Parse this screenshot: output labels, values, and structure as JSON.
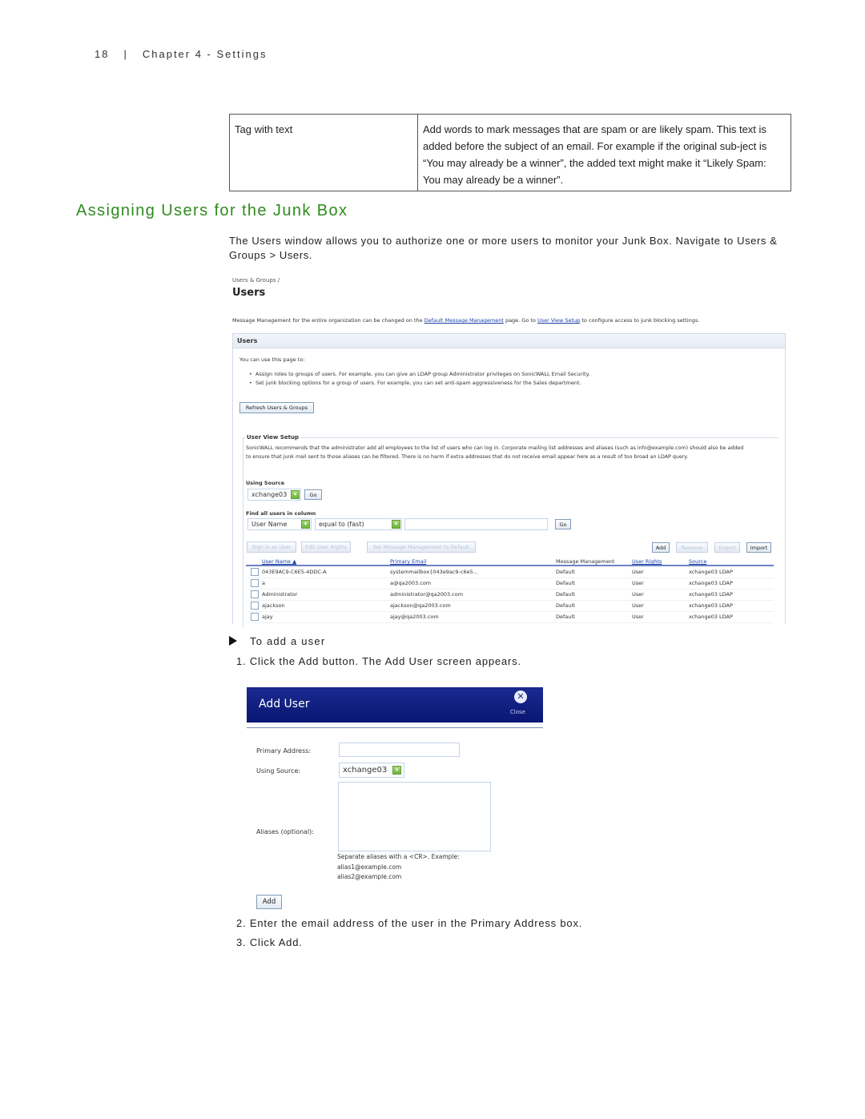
{
  "header": {
    "page_number": "18",
    "separator": "|",
    "chapter": "Chapter 4 - Settings"
  },
  "definition_table": {
    "rows": [
      {
        "term": "Tag with text",
        "description": "Add words to mark messages that are spam or are likely spam. This text is added before the subject of an email. For example if the original sub-ject is “You may already be a winner”, the added text might make it “Likely Spam: You may already be a winner”."
      }
    ]
  },
  "section": {
    "title": "Assigning Users for the Junk Box",
    "intro": "The Users window allows you to authorize one or more users to monitor your Junk Box. Navigate to Users & Groups > Users."
  },
  "users_screen": {
    "breadcrumb": "Users & Groups /",
    "title": "Users",
    "desc_pre": "Message Management for the entire organization can be changed on the ",
    "desc_link1": "Default Message Management",
    "desc_mid": " page. Go to ",
    "desc_link2": "User View Setup",
    "desc_post": " to configure access to junk blocking settings.",
    "panel_title": "Users",
    "lead": "You can use this page to:",
    "bullets": [
      "Assign roles to groups of users. For example, you can give an LDAP group Administrator privileges on SonicWALL Email Security.",
      "Set junk blocking options for a group of users. For example, you can set anti-spam aggressiveness for the Sales department."
    ],
    "refresh_button": "Refresh Users & Groups",
    "user_view_setup": {
      "legend": "User View Setup",
      "text_line1": "SonicWALL recommends that the administrator add all employees to the list of users who can log in. Corporate mailing list addresses and aliases (such as info@example.com) should also be added",
      "text_line2": "to ensure that junk mail sent to those aliases can be filtered. There is no harm if extra addresses that do not receive email appear here as a result of too broad an LDAP query.",
      "using_source_label": "Using Source",
      "using_source_value": "xchange03",
      "go_label": "Go",
      "find_label": "Find all users in column",
      "find_column_value": "User Name",
      "find_operator_value": "equal to (fast)",
      "find_text_value": "",
      "find_go_label": "Go"
    },
    "actions": {
      "sign_in": "Sign in as User",
      "edit_rights": "Edit User Rights",
      "set_default": "Set Message Management to Default",
      "add": "Add",
      "remove": "Remove",
      "export": "Export",
      "import": "Import"
    },
    "table": {
      "columns": [
        "User Name ▲",
        "Primary Email",
        "Message Management",
        "User Rights",
        "Source"
      ],
      "rows": [
        [
          "043E9AC9-C6E5-4DDC-A",
          "systemmailbox{043e9ac9-c6e5...",
          "Default",
          "User",
          "xchange03 LDAP"
        ],
        [
          "a",
          "a@qa2003.com",
          "Default",
          "User",
          "xchange03 LDAP"
        ],
        [
          "Administrator",
          "administrator@qa2003.com",
          "Default",
          "User",
          "xchange03 LDAP"
        ],
        [
          "ajackson",
          "ajackson@qa2003.com",
          "Default",
          "User",
          "xchange03 LDAP"
        ],
        [
          "ajay",
          "ajay@qa2003.com",
          "Default",
          "User",
          "xchange03 LDAP"
        ]
      ]
    }
  },
  "procedure": {
    "title": "To add a user",
    "steps": [
      "1. Click the Add button. The Add User screen appears.",
      "2. Enter the email address of the user in the Primary Address box.",
      "3. Click Add."
    ]
  },
  "add_user_dialog": {
    "title": "Add User",
    "close_label": "Close",
    "primary_address_label": "Primary Address:",
    "primary_address_value": "",
    "using_source_label": "Using Source:",
    "using_source_value": "xchange03",
    "aliases_label": "Aliases (optional):",
    "aliases_value": "",
    "hint_line1": "Separate aliases with a <CR>. Example:",
    "hint_line2": "alias1@example.com",
    "hint_line3": "alias2@example.com",
    "add_button": "Add"
  }
}
